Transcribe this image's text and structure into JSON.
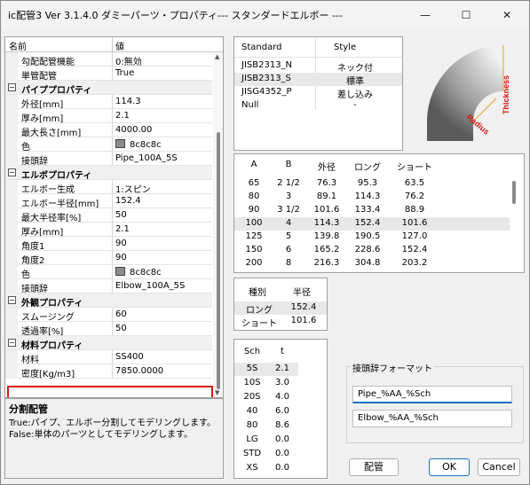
{
  "window": {
    "title": "ic配管3 Ver 3.1.4.0 ダミーパーツ・プロパティ--- スタンダードエルボー ---",
    "minimize": "—",
    "maximize": "☐",
    "close": "✕"
  },
  "grid": {
    "col_name": "名前",
    "col_value": "値",
    "rows": [
      {
        "k": "勾配配管機能",
        "v": "0:無効"
      },
      {
        "k": "単管配管",
        "v": "True"
      },
      {
        "cat": "パイププロパティ"
      },
      {
        "k": "外径[mm]",
        "v": "114.3"
      },
      {
        "k": "厚み[mm]",
        "v": "2.1"
      },
      {
        "k": "最大長さ[mm]",
        "v": "4000.00"
      },
      {
        "k": "色",
        "v": "8c8c8c",
        "swatch": true
      },
      {
        "k": "接頭辞",
        "v": "Pipe_100A_5S"
      },
      {
        "cat": "エルボプロパティ"
      },
      {
        "k": "エルボー生成",
        "v": "1:スピン"
      },
      {
        "k": "エルボー半径[mm]",
        "v": "152.4"
      },
      {
        "k": "最大半径率[%]",
        "v": "50"
      },
      {
        "k": "厚み[mm]",
        "v": "2.1"
      },
      {
        "k": "角度1",
        "v": "90"
      },
      {
        "k": "角度2",
        "v": "90"
      },
      {
        "k": "色",
        "v": "8c8c8c",
        "swatch": true
      },
      {
        "k": "接頭辞",
        "v": "Elbow_100A_5S"
      },
      {
        "cat": "外観プロパティ"
      },
      {
        "k": "スムージング",
        "v": "60"
      },
      {
        "k": "透過率[%]",
        "v": "50"
      },
      {
        "cat": "材料プロパティ"
      },
      {
        "k": "材料",
        "v": "SS400"
      },
      {
        "k": "密度[Kg/m3]",
        "v": "7850.0000"
      }
    ],
    "toggle": "−"
  },
  "description": {
    "title": "分割配管",
    "lines": [
      "True:パイプ、エルボー分割してモデリングします。",
      "False:単体のパーツとしてモデリングします。"
    ]
  },
  "standards": {
    "h_standard": "Standard",
    "h_style": "Style",
    "rows": [
      {
        "a": "JISB2313_N",
        "b": "ネック付"
      },
      {
        "a": "JISB2313_S",
        "b": "標準"
      },
      {
        "a": "JISG4352_P",
        "b": "差し込み"
      },
      {
        "a": "Null",
        "b": "-"
      }
    ]
  },
  "figure": {
    "radius": "Radius",
    "thickness": "Thickness"
  },
  "dims": {
    "headers": [
      "A",
      "B",
      "外径",
      "ロング",
      "ショート"
    ],
    "rows": [
      [
        "65",
        "2 1/2",
        "76.3",
        "95.3",
        "63.5"
      ],
      [
        "80",
        "3",
        "89.1",
        "114.3",
        "76.2"
      ],
      [
        "90",
        "3 1/2",
        "101.6",
        "133.4",
        "88.9"
      ],
      [
        "100",
        "4",
        "114.3",
        "152.4",
        "101.6"
      ],
      [
        "125",
        "5",
        "139.8",
        "190.5",
        "127.0"
      ],
      [
        "150",
        "6",
        "165.2",
        "228.6",
        "152.4"
      ],
      [
        "200",
        "8",
        "216.3",
        "304.8",
        "203.2"
      ]
    ]
  },
  "types": {
    "headers": [
      "種別",
      "半径"
    ],
    "rows": [
      [
        "ロング",
        "152.4"
      ],
      [
        "ショート",
        "101.6"
      ]
    ]
  },
  "sch": {
    "headers": [
      "Sch",
      "t"
    ],
    "rows": [
      [
        "5S",
        "2.1"
      ],
      [
        "10S",
        "3.0"
      ],
      [
        "20S",
        "4.0"
      ],
      [
        "40",
        "6.0"
      ],
      [
        "80",
        "8.6"
      ],
      [
        "LG",
        "0.0"
      ],
      [
        "STD",
        "0.0"
      ],
      [
        "XS",
        "0.0"
      ]
    ]
  },
  "prefix_format": {
    "label": "接頭辞フォーマット",
    "pipe": "Pipe_%AA_%Sch",
    "elbow": "Elbow_%AA_%Sch"
  },
  "buttons": {
    "piping": "配管",
    "ok": "OK",
    "cancel": "Cancel"
  }
}
